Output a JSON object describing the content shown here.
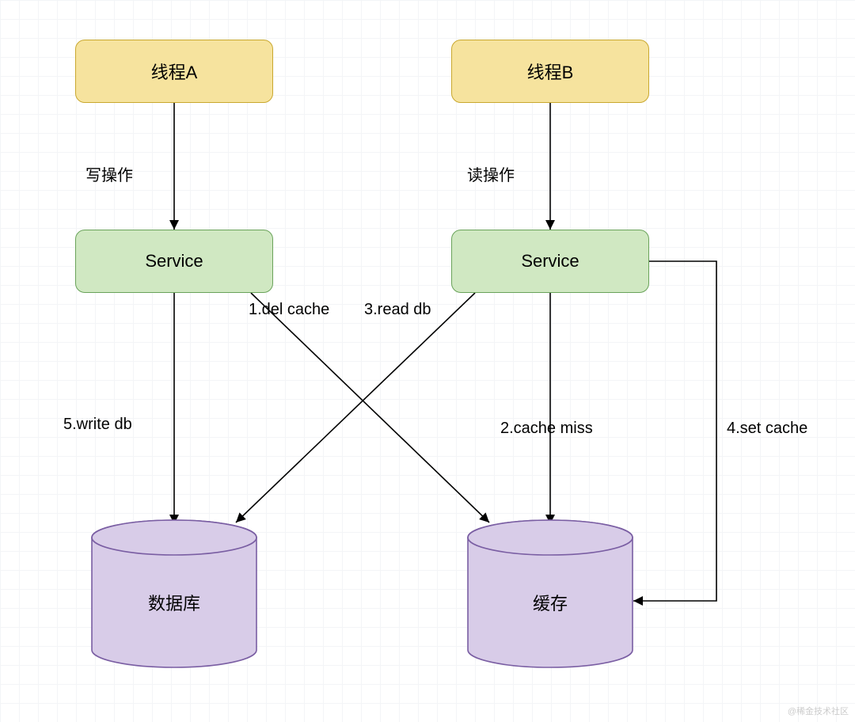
{
  "nodes": {
    "threadA": "线程A",
    "threadB": "线程B",
    "serviceA": "Service",
    "serviceB": "Service",
    "database": "数据库",
    "cache": "缓存"
  },
  "edges": {
    "writeOp": "写操作",
    "readOp": "读操作",
    "delCache": "1.del cache",
    "cacheMiss": "2.cache miss",
    "readDb": "3.read db",
    "setCache": "4.set cache",
    "writeDb": "5.write db"
  },
  "watermark": "@稀金技术社区"
}
